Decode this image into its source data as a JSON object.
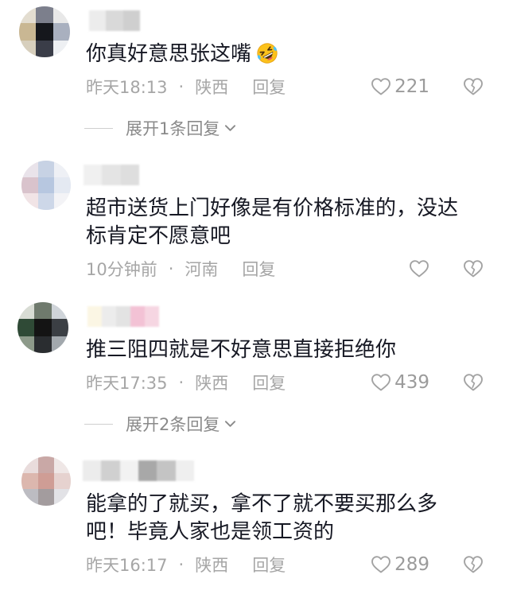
{
  "colors": {
    "background": "#ffffff",
    "text": "#161823",
    "meta": "#a6a6a6",
    "icon": "#a3a3a3",
    "expand": "#8a8a8a",
    "like_count": "#9b9b9b",
    "divider": "#cfcfcf"
  },
  "icons": {
    "like": "heart-outline-icon",
    "dislike": "broken-heart-icon",
    "expand": "chevron-down-icon",
    "emoji": "rofl-emoji-icon"
  },
  "comments": [
    {
      "avatar_colors": [
        "#e3ddd0",
        "#7c7f8c",
        "#e8e8e8",
        "#c9b793",
        "#15171c",
        "#a9b0bf",
        "#d7cfbd",
        "#3a3d48",
        "#eef0f3"
      ],
      "username_blur_colors": [
        "#ececec",
        "#d9d9d9",
        "#cfcfcf"
      ],
      "lines": [
        "你真好意思张这嘴"
      ],
      "emoji_icon": "rofl-emoji-icon",
      "time": "昨天18:13",
      "separator": "·",
      "region": "陕西",
      "reply": "回复",
      "likes": "221",
      "expand": "展开1条回复"
    },
    {
      "avatar_colors": [
        "#e9e3ea",
        "#c7d2e4",
        "#eef0f5",
        "#d9c3cc",
        "#b7c7e0",
        "#e4e9f2",
        "#f1e4e6",
        "#cdd7e8",
        "#f3f3f6"
      ],
      "username_blur_colors": [
        "#f0f0f0",
        "#e4e4e4",
        "#dedede"
      ],
      "lines": [
        "超市送货上门好像是有价格标准的，没达",
        "标肯定不愿意吧"
      ],
      "time": "10分钟前",
      "separator": "·",
      "region": "河南",
      "reply": "回复"
    },
    {
      "avatar_colors": [
        "#d8dcd4",
        "#6f7a6d",
        "#cfd4d9",
        "#2f4a36",
        "#141414",
        "#3b3f44",
        "#8d9a8a",
        "#2a2d30",
        "#a2a8ad"
      ],
      "username_blur_colors": [
        "#fbf6e4",
        "#ececec",
        "#e3e3e3",
        "#f3c2d5",
        "#f6d6e2"
      ],
      "lines": [
        "推三阻四就是不好意思直接拒绝你"
      ],
      "time": "昨天17:35",
      "separator": "·",
      "region": "陕西",
      "reply": "回复",
      "likes": "439",
      "expand": "展开2条回复"
    },
    {
      "avatar_colors": [
        "#e9dcdc",
        "#c9a8a6",
        "#efe7e6",
        "#dcb7ae",
        "#cf9d95",
        "#e6d2cf",
        "#bcbcc2",
        "#a39c9e",
        "#e2e2e6"
      ],
      "username_blur_colors": [
        "#ececec",
        "#d0d0d0",
        "#f2f2f2",
        "#a8a8a8",
        "#c4c4c4",
        "#efefef"
      ],
      "lines": [
        "能拿的了就买，拿不了就不要买那么多",
        "吧！毕竟人家也是领工资的"
      ],
      "time": "昨天16:17",
      "separator": "·",
      "region": "陕西",
      "reply": "回复",
      "likes": "289"
    }
  ]
}
